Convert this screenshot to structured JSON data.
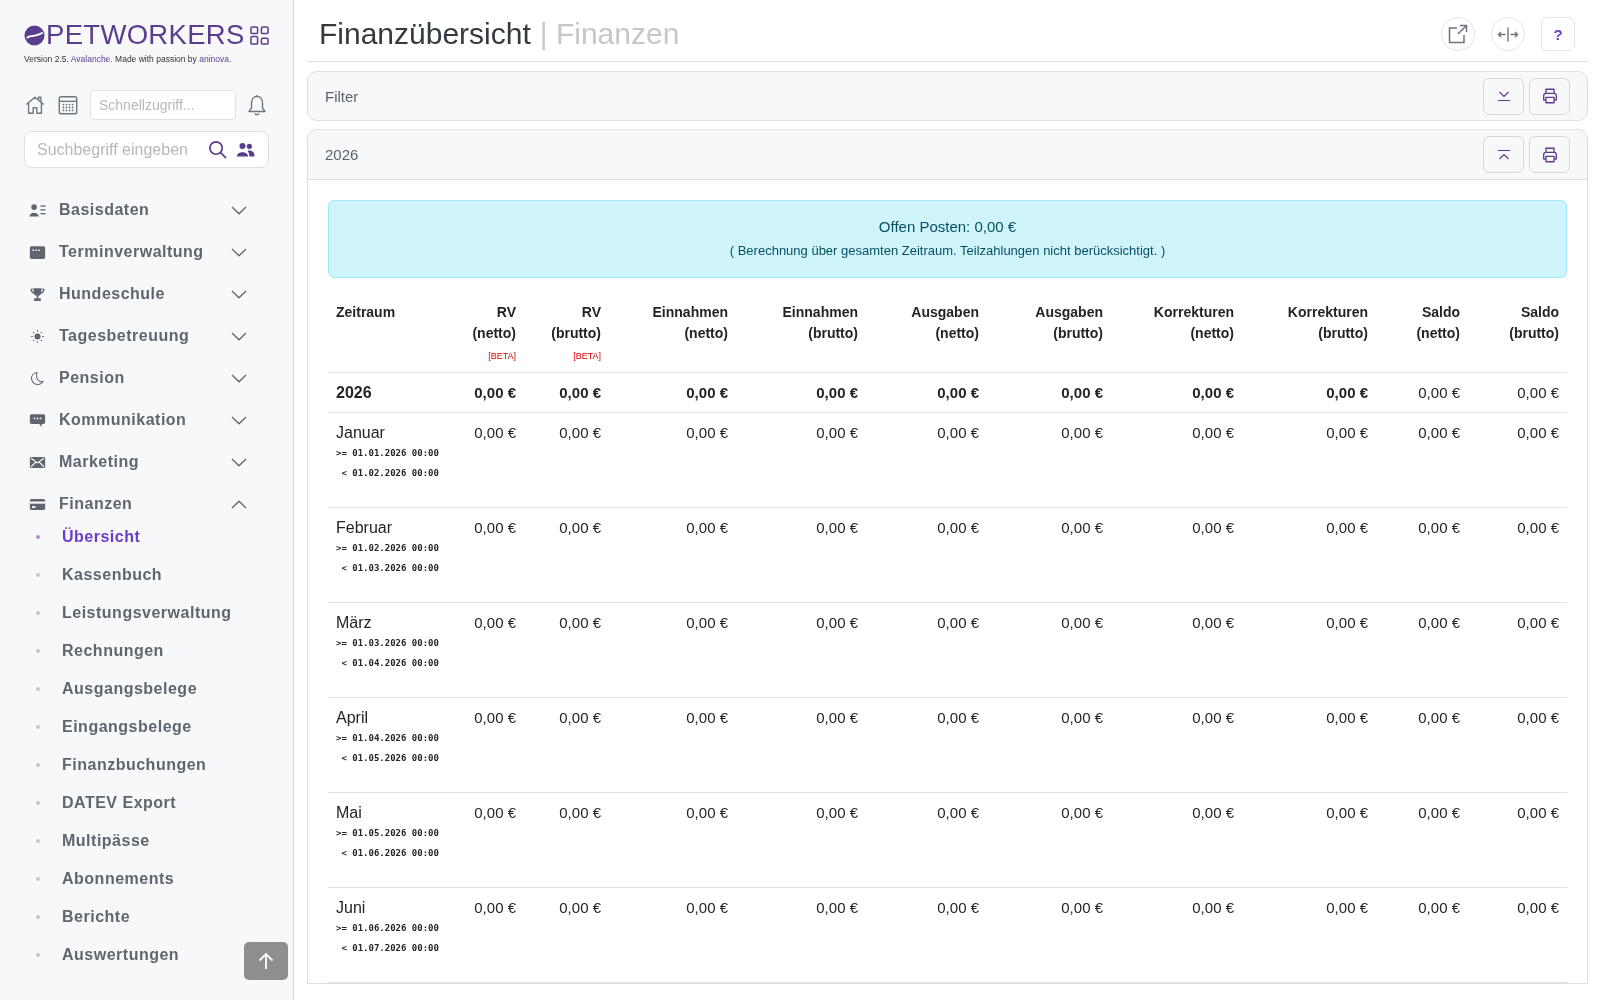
{
  "sidebar": {
    "logo": "PETWORKERS",
    "version": {
      "prefix": "Version 2.5.",
      "release": "Avalanche.",
      "middle": "Made with passion by",
      "company": "aninova."
    },
    "quick_access": {
      "placeholder": "Schnellzugriff..."
    },
    "search": {
      "placeholder": "Suchbegriff eingeben"
    },
    "items": [
      {
        "label": "Basisdaten",
        "expanded": false
      },
      {
        "label": "Terminverwaltung",
        "expanded": false
      },
      {
        "label": "Hundeschule",
        "expanded": false
      },
      {
        "label": "Tagesbetreuung",
        "expanded": false
      },
      {
        "label": "Pension",
        "expanded": false
      },
      {
        "label": "Kommunikation",
        "expanded": false
      },
      {
        "label": "Marketing",
        "expanded": false
      },
      {
        "label": "Finanzen",
        "expanded": true,
        "children": [
          {
            "label": "Übersicht",
            "selected": true
          },
          {
            "label": "Kassenbuch",
            "selected": false
          },
          {
            "label": "Leistungsverwaltung",
            "selected": false
          },
          {
            "label": "Rechnungen",
            "selected": false
          },
          {
            "label": "Ausgangsbelege",
            "selected": false
          },
          {
            "label": "Eingangsbelege",
            "selected": false
          },
          {
            "label": "Finanzbuchungen",
            "selected": false
          },
          {
            "label": "DATEV Export",
            "selected": false
          },
          {
            "label": "Multipässe",
            "selected": false
          },
          {
            "label": "Abonnements",
            "selected": false
          },
          {
            "label": "Berichte",
            "selected": false
          },
          {
            "label": "Auswertungen",
            "selected": false
          }
        ]
      }
    ]
  },
  "header": {
    "title": "Finanzübersicht",
    "section": "| Finanzen",
    "help": "?"
  },
  "filter_panel": {
    "title": "Filter",
    "expanded": false
  },
  "year_panel": {
    "title": "2026",
    "expanded": true,
    "alert": {
      "title": "Offen Posten: 0,00 €",
      "note": "( Berechnung über gesamten Zeitraum. Teilzahlungen nicht berücksichtigt. )"
    },
    "table": {
      "columns": [
        {
          "label": "Zeitraum",
          "kind": "period"
        },
        {
          "label": "RV",
          "unit": "(netto)",
          "tag": "[BETA]",
          "kind": "amount"
        },
        {
          "label": "RV",
          "unit": "(brutto)",
          "tag": "[BETA]",
          "kind": "amount"
        },
        {
          "label": "Einnahmen",
          "unit": "(netto)",
          "kind": "amount"
        },
        {
          "label": "Einnahmen",
          "unit": "(brutto)",
          "kind": "amount"
        },
        {
          "label": "Ausgaben",
          "unit": "(netto)",
          "kind": "amount"
        },
        {
          "label": "Ausgaben",
          "unit": "(brutto)",
          "kind": "amount"
        },
        {
          "label": "Korrekturen",
          "unit": "(netto)",
          "kind": "amount"
        },
        {
          "label": "Korrekturen",
          "unit": "(brutto)",
          "kind": "amount"
        },
        {
          "label": "Saldo",
          "unit": "(netto)",
          "kind": "balance"
        },
        {
          "label": "Saldo",
          "unit": "(brutto)",
          "kind": "balance"
        }
      ],
      "rows": [
        {
          "kind": "total",
          "label": "2026",
          "values": [
            "0,00 €",
            "0,00 €",
            "0,00 €",
            "0,00 €",
            "0,00 €",
            "0,00 €",
            "0,00 €",
            "0,00 €",
            "0,00 €",
            "0,00 €"
          ]
        },
        {
          "kind": "month",
          "label": "Januar",
          "from": ">= 01.01.2026 00:00",
          "to": "< 01.02.2026 00:00",
          "values": [
            "0,00 €",
            "0,00 €",
            "0,00 €",
            "0,00 €",
            "0,00 €",
            "0,00 €",
            "0,00 €",
            "0,00 €",
            "0,00 €",
            "0,00 €"
          ]
        },
        {
          "kind": "month",
          "label": "Februar",
          "from": ">= 01.02.2026 00:00",
          "to": "< 01.03.2026 00:00",
          "values": [
            "0,00 €",
            "0,00 €",
            "0,00 €",
            "0,00 €",
            "0,00 €",
            "0,00 €",
            "0,00 €",
            "0,00 €",
            "0,00 €",
            "0,00 €"
          ]
        },
        {
          "kind": "month",
          "label": "März",
          "from": ">= 01.03.2026 00:00",
          "to": "< 01.04.2026 00:00",
          "values": [
            "0,00 €",
            "0,00 €",
            "0,00 €",
            "0,00 €",
            "0,00 €",
            "0,00 €",
            "0,00 €",
            "0,00 €",
            "0,00 €",
            "0,00 €"
          ]
        },
        {
          "kind": "month",
          "label": "April",
          "from": ">= 01.04.2026 00:00",
          "to": "< 01.05.2026 00:00",
          "values": [
            "0,00 €",
            "0,00 €",
            "0,00 €",
            "0,00 €",
            "0,00 €",
            "0,00 €",
            "0,00 €",
            "0,00 €",
            "0,00 €",
            "0,00 €"
          ]
        },
        {
          "kind": "month",
          "label": "Mai",
          "from": ">= 01.05.2026 00:00",
          "to": "< 01.06.2026 00:00",
          "values": [
            "0,00 €",
            "0,00 €",
            "0,00 €",
            "0,00 €",
            "0,00 €",
            "0,00 €",
            "0,00 €",
            "0,00 €",
            "0,00 €",
            "0,00 €"
          ]
        },
        {
          "kind": "month",
          "label": "Juni",
          "from": ">= 01.06.2026 00:00",
          "to": "< 01.07.2026 00:00",
          "values": [
            "0,00 €",
            "0,00 €",
            "0,00 €",
            "0,00 €",
            "0,00 €",
            "0,00 €",
            "0,00 €",
            "0,00 €",
            "0,00 €",
            "0,00 €"
          ]
        }
      ]
    }
  }
}
